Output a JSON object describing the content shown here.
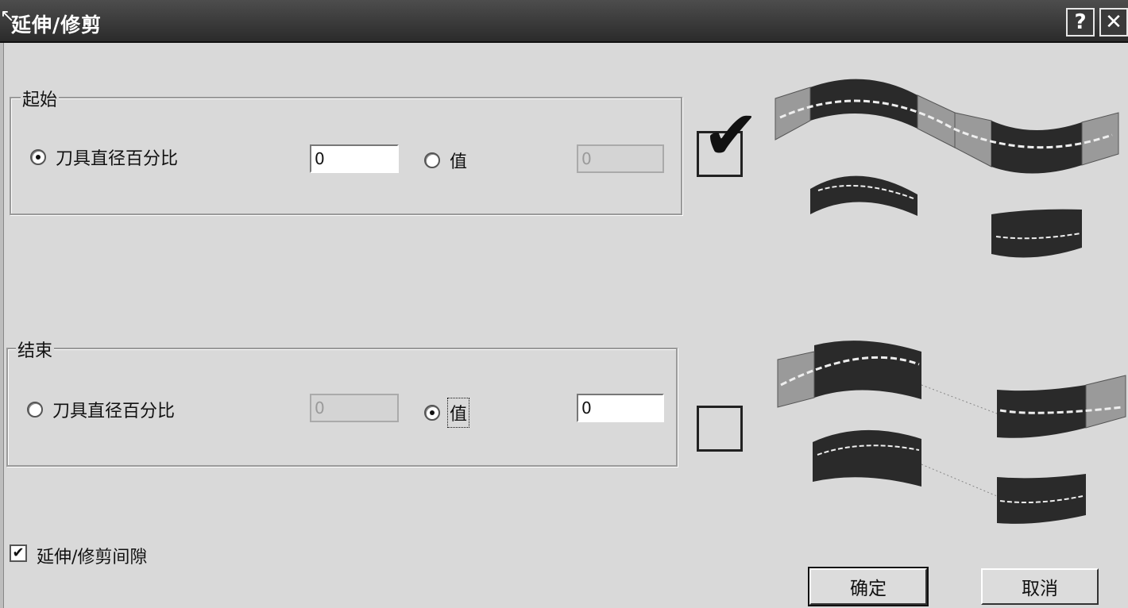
{
  "window": {
    "title": "延伸/修剪",
    "help_label": "?",
    "close_label": "✕"
  },
  "start_group": {
    "legend": "起始",
    "option_percent_label": "刀具直径百分比",
    "percent_value": "0",
    "option_value_label": "值",
    "value_value": "0",
    "selected": "percent"
  },
  "end_group": {
    "legend": "结束",
    "option_percent_label": "刀具直径百分比",
    "percent_value": "0",
    "option_value_label": "值",
    "value_value": "0",
    "selected": "value"
  },
  "start_big_check": {
    "checked": true,
    "glyph": "✔"
  },
  "end_big_check": {
    "checked": false
  },
  "gap_option": {
    "label": "延伸/修剪间隙",
    "checked": true,
    "glyph": "✔"
  },
  "buttons": {
    "ok": "确定",
    "cancel": "取消"
  },
  "colors": {
    "titlebar": "#333333",
    "background": "#d9d9d9",
    "strip_dark": "#2a2a2a",
    "strip_ext": "#9a9a9a"
  }
}
